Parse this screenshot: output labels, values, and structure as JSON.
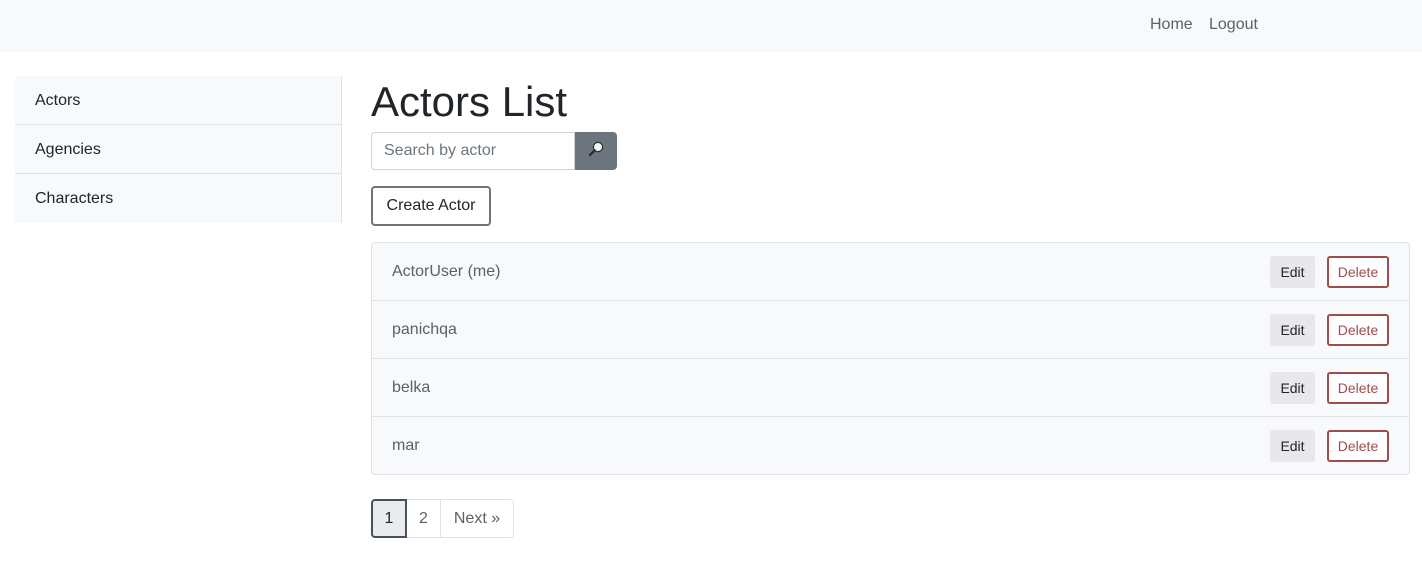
{
  "nav": {
    "home": "Home",
    "logout": "Logout"
  },
  "sidebar": {
    "items": [
      {
        "label": "Actors"
      },
      {
        "label": "Agencies"
      },
      {
        "label": "Characters"
      }
    ]
  },
  "main": {
    "title": "Actors List",
    "search": {
      "placeholder": "Search by actor",
      "value": "",
      "icon": "magnifier-icon"
    },
    "create_label": "Create Actor",
    "rows": [
      {
        "name": "ActorUser (me)",
        "edit": "Edit",
        "delete": "Delete"
      },
      {
        "name": "panichqa",
        "edit": "Edit",
        "delete": "Delete"
      },
      {
        "name": "belka",
        "edit": "Edit",
        "delete": "Delete"
      },
      {
        "name": "mar",
        "edit": "Edit",
        "delete": "Delete"
      }
    ]
  },
  "pagination": {
    "pages": [
      "1",
      "2"
    ],
    "next": "Next »",
    "current": "1"
  },
  "colors": {
    "navbar_bg": "#f8f9fa",
    "search_button": "#6c757d",
    "delete_accent": "#9e4d4d",
    "edit_bg": "#e9e6ec"
  }
}
